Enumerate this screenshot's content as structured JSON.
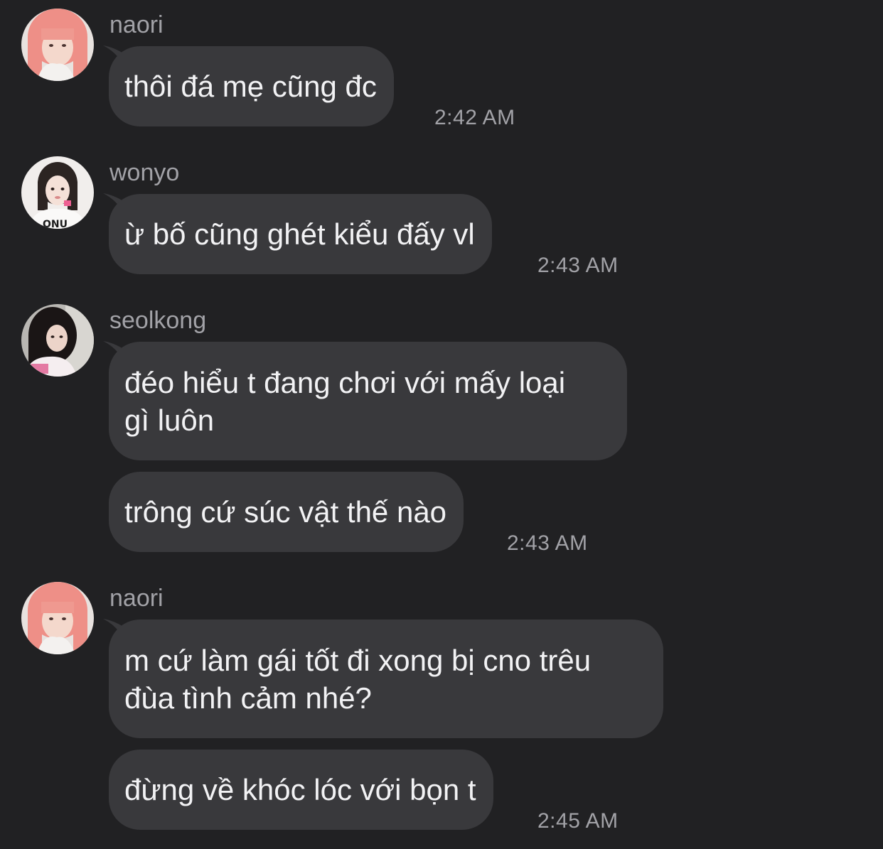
{
  "theme": {
    "background": "#212123",
    "bubble": "#39393c",
    "text": "#f2f2f4",
    "meta_text": "#a2a2a7"
  },
  "messages": [
    {
      "sender": "naori",
      "avatar_icon": "pink-hair-avatar-icon",
      "text": "thôi đá mẹ cũng đc",
      "time": "2:42 AM"
    },
    {
      "sender": "wonyo",
      "avatar_icon": "dark-hair-avatar-icon",
      "text": "ừ bố cũng ghét kiểu đấy vl",
      "time": "2:43 AM"
    },
    {
      "sender": "seolkong",
      "avatar_icon": "black-hair-avatar-icon",
      "text": "đéo hiểu t đang chơi với mấy loại\ngì luôn",
      "time": ""
    },
    {
      "sender": "",
      "text": "trông cứ súc vật thế nào",
      "time": "2:43 AM"
    },
    {
      "sender": "naori",
      "avatar_icon": "pink-hair-avatar-icon",
      "text": "m cứ làm gái tốt đi xong bị cno trêu\nđùa tình cảm nhé?",
      "time": ""
    },
    {
      "sender": "",
      "text": "đừng về khóc lóc với bọn t",
      "time": "2:45 AM"
    }
  ]
}
